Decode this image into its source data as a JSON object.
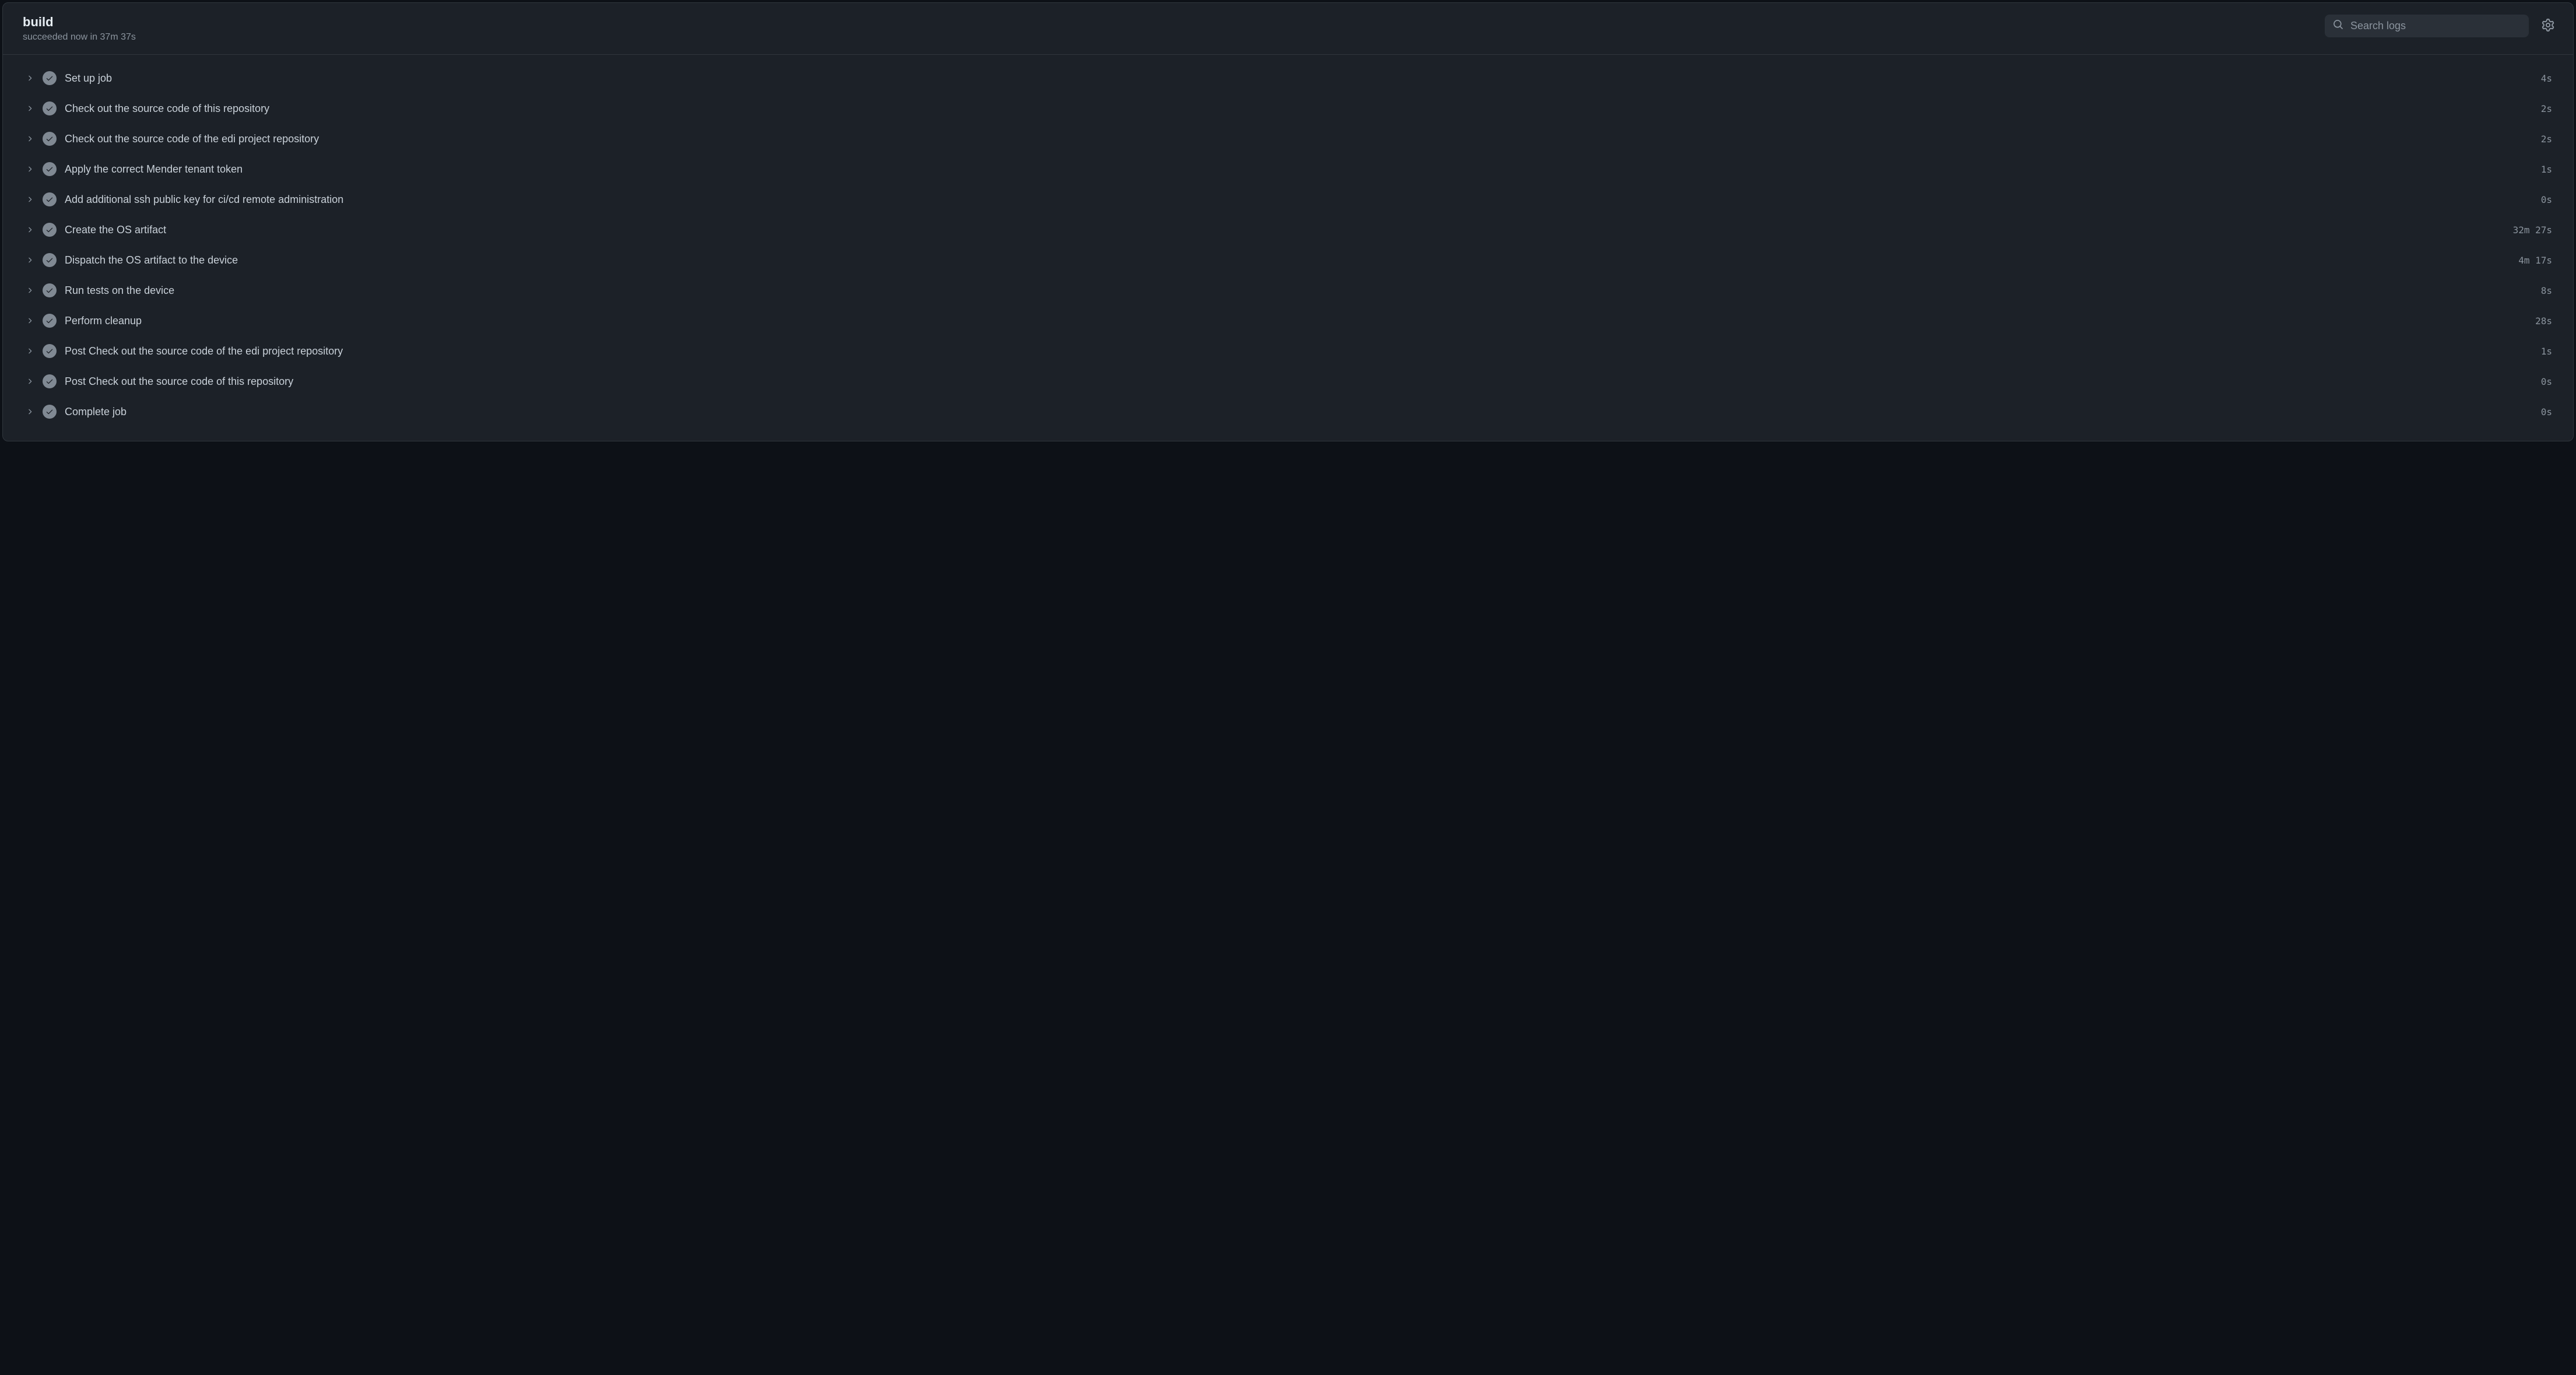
{
  "header": {
    "title": "build",
    "subtitle": "succeeded now in 37m 37s"
  },
  "search": {
    "placeholder": "Search logs"
  },
  "steps": [
    {
      "name": "Set up job",
      "duration": "4s"
    },
    {
      "name": "Check out the source code of this repository",
      "duration": "2s"
    },
    {
      "name": "Check out the source code of the edi project repository",
      "duration": "2s"
    },
    {
      "name": "Apply the correct Mender tenant token",
      "duration": "1s"
    },
    {
      "name": "Add additional ssh public key for ci/cd remote administration",
      "duration": "0s"
    },
    {
      "name": "Create the OS artifact",
      "duration": "32m 27s"
    },
    {
      "name": "Dispatch the OS artifact to the device",
      "duration": "4m 17s"
    },
    {
      "name": "Run tests on the device",
      "duration": "8s"
    },
    {
      "name": "Perform cleanup",
      "duration": "28s"
    },
    {
      "name": "Post Check out the source code of the edi project repository",
      "duration": "1s"
    },
    {
      "name": "Post Check out the source code of this repository",
      "duration": "0s"
    },
    {
      "name": "Complete job",
      "duration": "0s"
    }
  ]
}
